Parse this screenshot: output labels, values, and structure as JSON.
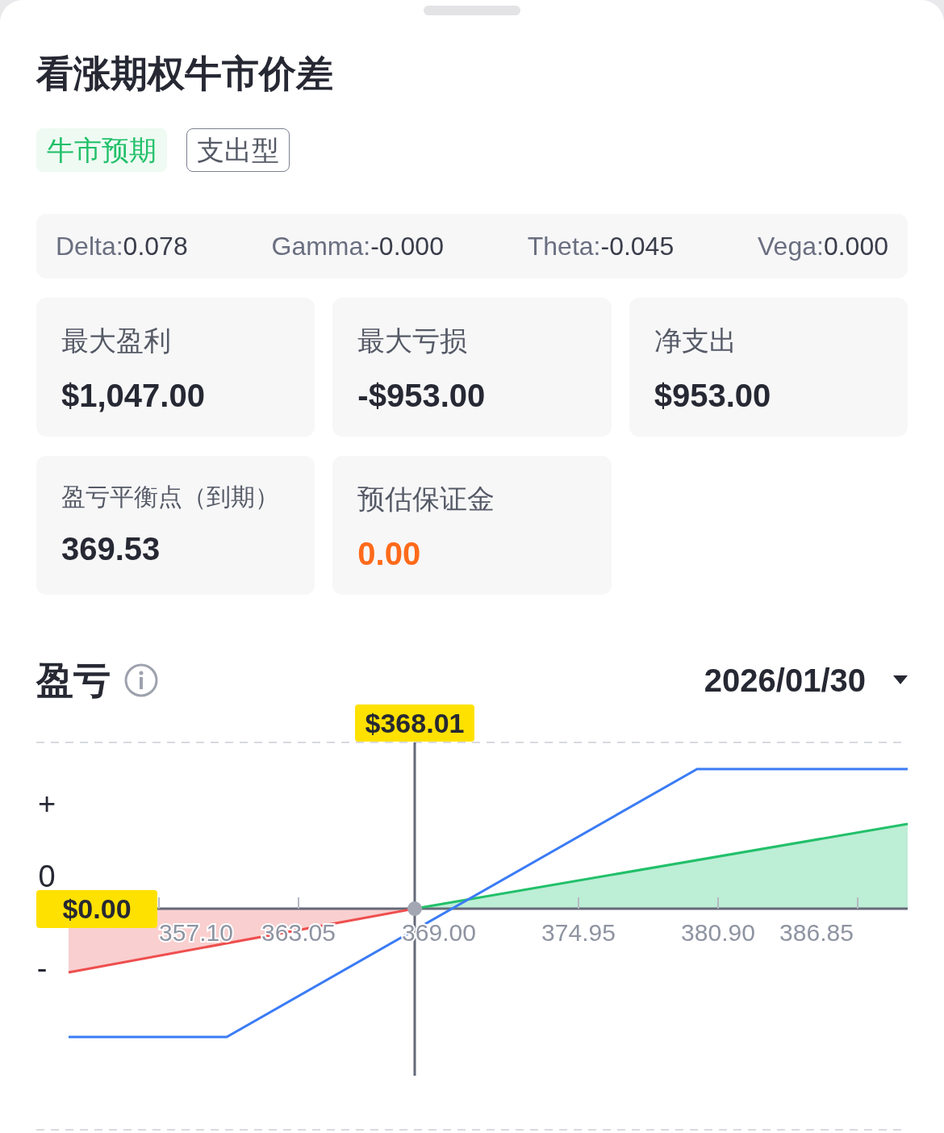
{
  "title": "看涨期权牛市价差",
  "tags": [
    {
      "label": "牛市预期",
      "kind": "filled"
    },
    {
      "label": "支出型",
      "kind": "outlined"
    }
  ],
  "greeks": [
    {
      "label": "Delta:",
      "value": "0.078"
    },
    {
      "label": "Gamma:",
      "value": "-0.000"
    },
    {
      "label": "Theta:",
      "value": "-0.045"
    },
    {
      "label": "Vega:",
      "value": "0.000"
    }
  ],
  "metrics": [
    {
      "label": "最大盈利",
      "value": "$1,047.00",
      "highlight": false
    },
    {
      "label": "最大亏损",
      "value": "-$953.00",
      "highlight": false
    },
    {
      "label": "净支出",
      "value": "$953.00",
      "highlight": false
    },
    {
      "label": "盈亏平衡点（到期）",
      "value": "369.53",
      "highlight": false
    },
    {
      "label": "预估保证金",
      "value": "0.00",
      "highlight": true
    }
  ],
  "pnl": {
    "title": "盈亏",
    "date": "2026/01/30",
    "y_labels": [
      "+",
      "0",
      "-"
    ],
    "x_labels": [
      "357.10",
      "363.05",
      "369.00",
      "374.95",
      "380.90",
      "386.85"
    ],
    "cursor_price": "$368.01",
    "cursor_pnl": "$0.00"
  }
}
